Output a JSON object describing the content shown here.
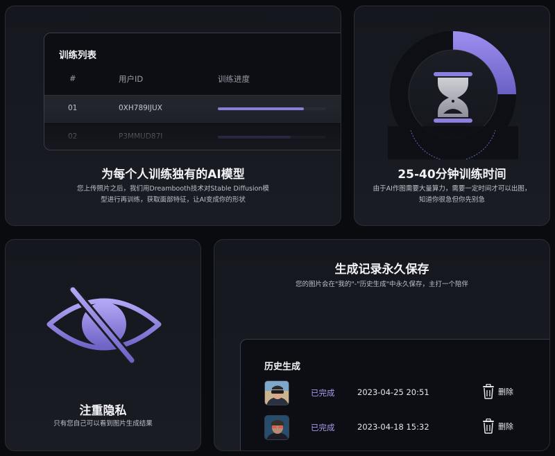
{
  "training_card": {
    "panel_title": "训练列表",
    "columns": [
      "#",
      "用户ID",
      "训练进度"
    ],
    "rows": [
      {
        "index": "01",
        "user_id": "0XH789IJUX",
        "progress": 0.8
      },
      {
        "index": "02",
        "user_id": "P3MMUD87I",
        "progress": 0.68
      }
    ],
    "title": "为每个人训练独有的AI模型",
    "desc_line1": "您上传照片之后，我们用Dreambooth技术对Stable Diffusion模",
    "desc_line2": "型进行再训练，获取面部特征，让AI变成你的形状"
  },
  "time_card": {
    "title": "25-40分钟训练时间",
    "desc_line1": "由于AI作图需要大量算力，需要一定时间才可以出图，",
    "desc_line2": "知道你很急但你先别急",
    "progress": 0.25,
    "icon": "hourglass-icon"
  },
  "privacy_card": {
    "title": "注重隐私",
    "desc": "只有您自己可以看到图片生成结果",
    "icon": "eye-off-icon"
  },
  "history_card": {
    "title": "生成记录永久保存",
    "desc": "您的图片会在\"我的\"-\"历史生成\"中永久保存，主打一个陪伴",
    "panel_title": "历史生成",
    "rows": [
      {
        "status": "已完成",
        "time": "2023-04-25 20:51",
        "delete_label": "删除"
      },
      {
        "status": "已完成",
        "time": "2023-04-18 15:32",
        "delete_label": "删除"
      }
    ]
  },
  "colors": {
    "accent": "#8b80e0",
    "accent_light": "#a99bf0",
    "background": "#0a0b0f",
    "card": "#181a21"
  }
}
